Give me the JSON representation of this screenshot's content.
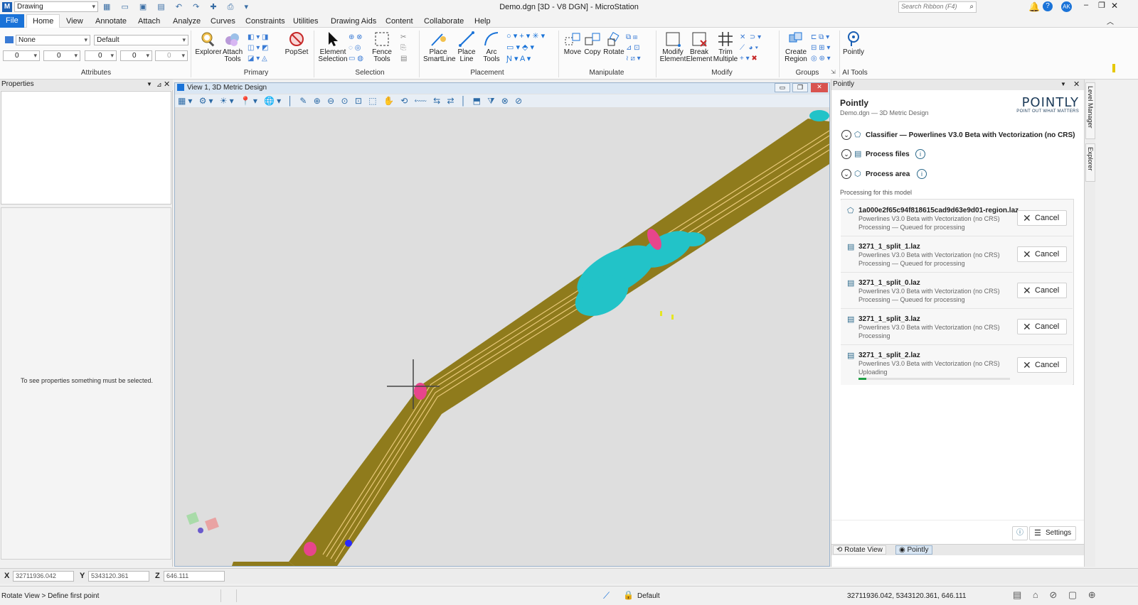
{
  "window": {
    "title": "Demo.dgn [3D - V8 DGN] - MicroStation",
    "workflow": "Drawing",
    "search_placeholder": "Search Ribbon (F4)",
    "user_initials": "AK"
  },
  "tabs": [
    "File",
    "Home",
    "View",
    "Annotate",
    "Attach",
    "Analyze",
    "Curves",
    "Constraints",
    "Utilities",
    "Drawing Aids",
    "Content",
    "Collaborate",
    "Help"
  ],
  "attributes": {
    "level": "None",
    "style": "Default",
    "color": "0",
    "weight": "0",
    "linestyle": "0",
    "transparency": "0",
    "priority": "0",
    "label": "Attributes"
  },
  "ribbon": {
    "primary": {
      "label": "Primary",
      "explorer": "Explorer",
      "attach_tools": "Attach Tools",
      "popset": "PopSet"
    },
    "selection": {
      "label": "Selection",
      "element_selection": "Element Selection",
      "fence_tools": "Fence Tools"
    },
    "placement": {
      "label": "Placement",
      "place_smartline": "Place SmartLine",
      "place_line": "Place Line",
      "arc_tools": "Arc Tools"
    },
    "manipulate": {
      "label": "Manipulate",
      "move": "Move",
      "copy": "Copy",
      "rotate": "Rotate"
    },
    "modify": {
      "label": "Modify",
      "modify_element": "Modify Element",
      "break_element": "Break Element",
      "trim_multiple": "Trim Multiple"
    },
    "groups": {
      "label": "Groups",
      "create_region": "Create Region"
    },
    "ai_tools": {
      "label": "AI Tools",
      "pointly": "Pointly"
    }
  },
  "properties": {
    "title": "Properties",
    "empty_message": "To see properties something must be selected."
  },
  "view": {
    "title": "View 1, 3D Metric Design"
  },
  "pointly_panel": {
    "panel_title": "Pointly",
    "title": "Pointly",
    "subtitle": "Demo.dgn — 3D Metric Design",
    "logo_text": "POINTLY",
    "logo_tagline": "POINT OUT WHAT MATTERS",
    "classifier": "Classifier — Powerlines V3.0 Beta with Vectorization (no CRS)",
    "process_files": "Process files",
    "process_area": "Process area",
    "section_label": "Processing for this model",
    "cancel_label": "Cancel",
    "settings_label": "Settings",
    "jobs": [
      {
        "file": "1a000e2f65c94f818615cad9d63e9d01-region.laz",
        "model": "Powerlines V3.0 Beta with Vectorization (no CRS)",
        "status": "Processing — Queued for processing",
        "icon": "region-icon"
      },
      {
        "file": "3271_1_split_1.laz",
        "model": "Powerlines V3.0 Beta with Vectorization (no CRS)",
        "status": "Processing — Queued for processing",
        "icon": "file-icon"
      },
      {
        "file": "3271_1_split_0.laz",
        "model": "Powerlines V3.0 Beta with Vectorization (no CRS)",
        "status": "Processing — Queued for processing",
        "icon": "file-icon"
      },
      {
        "file": "3271_1_split_3.laz",
        "model": "Powerlines V3.0 Beta with Vectorization (no CRS)",
        "status": "Processing",
        "icon": "file-icon"
      },
      {
        "file": "3271_1_split_2.laz",
        "model": "Powerlines V3.0 Beta with Vectorization (no CRS)",
        "status": "Uploading",
        "icon": "file-icon",
        "progress": 0.05
      }
    ],
    "bottom_tabs": [
      "Rotate View",
      "Pointly"
    ]
  },
  "side_tabs": [
    "Level Manager",
    "Explorer"
  ],
  "coords": {
    "x_label": "X",
    "x": "32711936.042",
    "y_label": "Y",
    "y": "5343120.361",
    "z_label": "Z",
    "z": "646.111"
  },
  "status": {
    "prompt": "Rotate View > Define first point",
    "level": "Default",
    "coordinates": "32711936.042, 5343120.361, 646.111"
  },
  "colors": {
    "accent": "#1a73d8",
    "ground": "#8f7b1c",
    "vegetation": "#22c3c8",
    "tower": "#e8458c",
    "viewport_bg": "#dedede"
  }
}
